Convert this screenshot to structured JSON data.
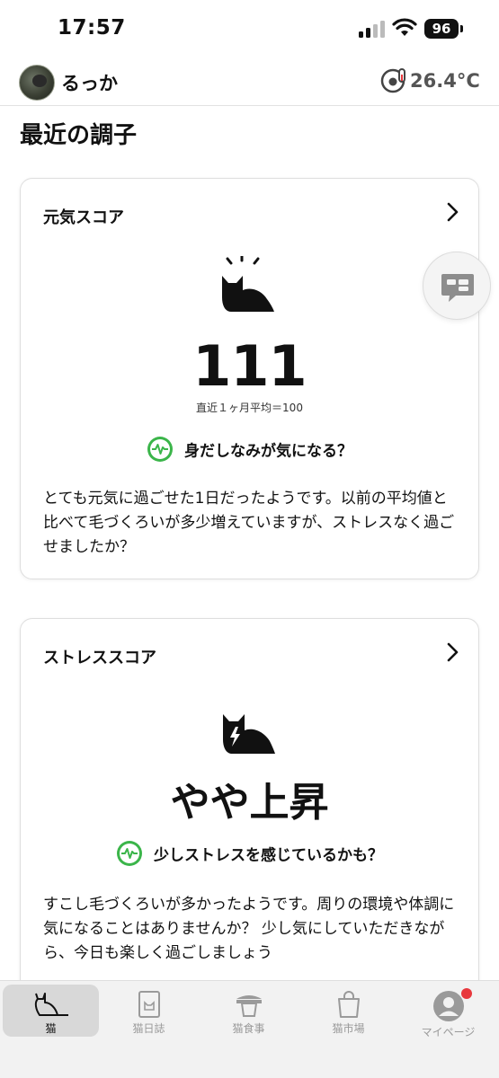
{
  "status_bar": {
    "time": "17:57",
    "battery": "96"
  },
  "header": {
    "user_name": "るっか",
    "temperature": "26.4°C"
  },
  "page_title": "最近の調子",
  "cards": [
    {
      "title": "元気スコア",
      "icon": "cat-sun-icon",
      "score": "111",
      "average": "直近１ヶ月平均＝100",
      "tag": "身だしなみが気になる？",
      "body": "とても元気に過ごせた1日だったようです。以前の平均値と比べて毛づくろいが多少増えていますが、ストレスなく過ごせましたか？"
    },
    {
      "title": "ストレススコア",
      "icon": "cat-lightning-icon",
      "score": "やや上昇",
      "tag": "少しストレスを感じているかも？",
      "body": "すこし毛づくろいが多かったようです。周りの環境や体調に気になることはありませんか？ 少し気にしていただきながら、今日も楽しく過ごしましょう"
    }
  ],
  "tabs": [
    {
      "label": "猫",
      "icon": "cat-icon",
      "active": true
    },
    {
      "label": "猫日誌",
      "icon": "diary-icon",
      "active": false
    },
    {
      "label": "猫食事",
      "icon": "food-icon",
      "active": false
    },
    {
      "label": "猫市場",
      "icon": "shopping-bag-icon",
      "active": false
    },
    {
      "label": "マイページ",
      "icon": "profile-icon",
      "active": false,
      "notification": true
    }
  ],
  "colors": {
    "accent_green": "#3bb54a",
    "notification_red": "#e8383d",
    "text": "#111111"
  }
}
